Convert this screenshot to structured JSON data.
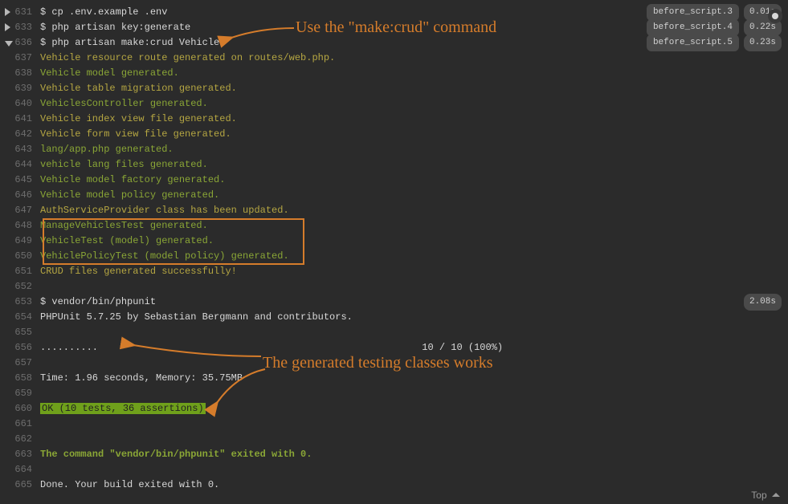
{
  "lines": [
    {
      "num": 631,
      "fold": "right",
      "cls": "cmd",
      "text": "$ cp .env.example .env",
      "badge": {
        "stage": "before_script.3",
        "time": "0.01s"
      }
    },
    {
      "num": 633,
      "fold": "right",
      "cls": "cmd",
      "text": "$ php artisan key:generate",
      "badge": {
        "stage": "before_script.4",
        "time": "0.22s"
      }
    },
    {
      "num": 636,
      "fold": "down",
      "cls": "cmd",
      "text": "$ php artisan make:crud Vehicle",
      "badge": {
        "stage": "before_script.5",
        "time": "0.23s"
      }
    },
    {
      "num": 637,
      "cls": "yellow",
      "text": "Vehicle resource route generated on routes/web.php."
    },
    {
      "num": 638,
      "cls": "green",
      "text": "Vehicle model generated."
    },
    {
      "num": 639,
      "cls": "yellow",
      "text": "Vehicle table migration generated."
    },
    {
      "num": 640,
      "cls": "green",
      "text": "VehiclesController generated."
    },
    {
      "num": 641,
      "cls": "yellow",
      "text": "Vehicle index view file generated."
    },
    {
      "num": 642,
      "cls": "yellow",
      "text": "Vehicle form view file generated."
    },
    {
      "num": 643,
      "cls": "green",
      "text": "lang/app.php generated."
    },
    {
      "num": 644,
      "cls": "green",
      "text": "vehicle lang files generated."
    },
    {
      "num": 645,
      "cls": "green",
      "text": "Vehicle model factory generated."
    },
    {
      "num": 646,
      "cls": "green",
      "text": "Vehicle model policy generated."
    },
    {
      "num": 647,
      "cls": "yellow",
      "text": "AuthServiceProvider class has been updated."
    },
    {
      "num": 648,
      "cls": "green",
      "text": "ManageVehiclesTest generated."
    },
    {
      "num": 649,
      "cls": "green",
      "text": "VehicleTest (model) generated."
    },
    {
      "num": 650,
      "cls": "green",
      "text": "VehiclePolicyTest (model policy) generated."
    },
    {
      "num": 651,
      "cls": "yellow",
      "text": "CRUD files generated successfully!"
    },
    {
      "num": 652,
      "cls": "",
      "text": ""
    },
    {
      "num": 653,
      "cls": "cmd",
      "text": "$ vendor/bin/phpunit",
      "badge": {
        "time": "2.08s"
      }
    },
    {
      "num": 654,
      "cls": "cmd",
      "text": "PHPUnit 5.7.25 by Sebastian Bergmann and contributors."
    },
    {
      "num": 655,
      "cls": "",
      "text": ""
    },
    {
      "num": 656,
      "cls": "cmd",
      "text": "..........                                                        10 / 10 (100%)"
    },
    {
      "num": 657,
      "cls": "",
      "text": ""
    },
    {
      "num": 658,
      "cls": "cmd",
      "text": "Time: 1.96 seconds, Memory: 35.75MB"
    },
    {
      "num": 659,
      "cls": "",
      "text": ""
    },
    {
      "num": 660,
      "cls": "ok",
      "text": "OK (10 tests, 36 assertions)"
    },
    {
      "num": 661,
      "cls": "",
      "text": ""
    },
    {
      "num": 662,
      "cls": "",
      "text": ""
    },
    {
      "num": 663,
      "cls": "green bold",
      "text": "The command \"vendor/bin/phpunit\" exited with 0."
    },
    {
      "num": 664,
      "cls": "",
      "text": ""
    },
    {
      "num": 665,
      "cls": "cmd",
      "text": "Done. Your build exited with 0."
    }
  ],
  "annotations": {
    "makecrud": "Use the \"make:crud\" command",
    "tests": "The generated testing classes works"
  },
  "topLink": "Top"
}
